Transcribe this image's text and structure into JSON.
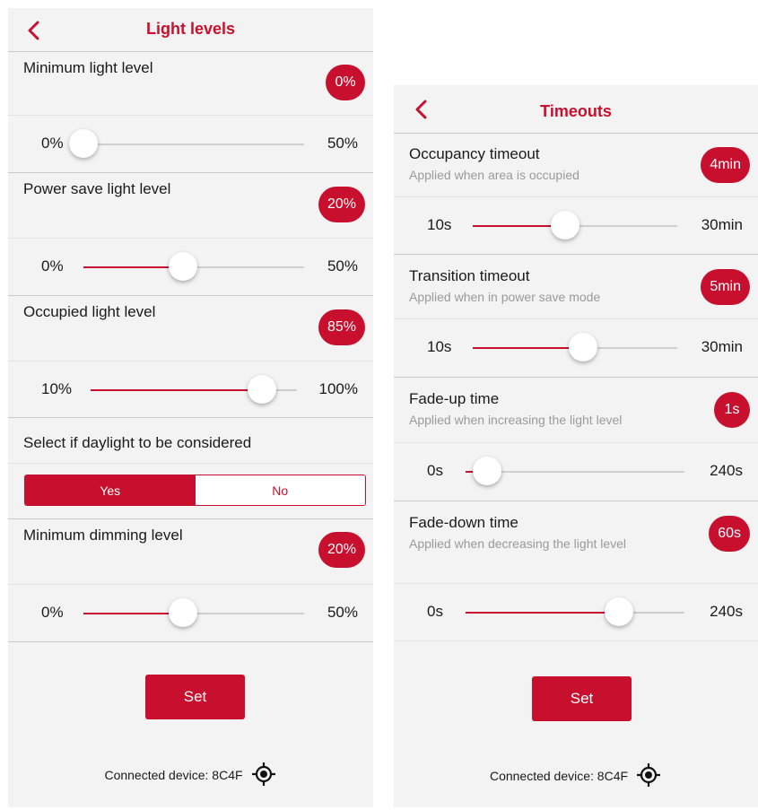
{
  "colors": {
    "accent": "#c8102e",
    "panel_bg": "#f3f3f3",
    "track": "#cfcfcf"
  },
  "left": {
    "title": "Light levels",
    "back_icon": "chevron-left-icon",
    "sliders": [
      {
        "label": "Minimum light level",
        "badge": "0%",
        "min": "0%",
        "max": "50%",
        "fraction": 0.0
      },
      {
        "label": "Power save light level",
        "badge": "20%",
        "min": "0%",
        "max": "50%",
        "fraction": 0.45
      },
      {
        "label": "Occupied light level",
        "badge": "85%",
        "min": "10%",
        "max": "100%",
        "fraction": 0.83
      }
    ],
    "daylight": {
      "label": "Select if daylight to be considered",
      "yes": "Yes",
      "no": "No",
      "selected": "Yes"
    },
    "dimming": {
      "label": "Minimum dimming level",
      "badge": "20%",
      "min": "0%",
      "max": "50%",
      "fraction": 0.45
    },
    "set_label": "Set",
    "footer": "Connected device: 8C4F",
    "footer_icon": "locate-icon"
  },
  "right": {
    "title": "Timeouts",
    "back_icon": "chevron-left-icon",
    "sliders": [
      {
        "label": "Occupancy timeout",
        "sub": "Applied when area is occupied",
        "badge": "4min",
        "min": "10s",
        "max": "30min",
        "fraction": 0.45
      },
      {
        "label": "Transition timeout",
        "sub": "Applied when in power save mode",
        "badge": "5min",
        "min": "10s",
        "max": "30min",
        "fraction": 0.54
      },
      {
        "label": "Fade-up time",
        "sub": "Applied when increasing the light level",
        "badge": "1s",
        "min": "0s",
        "max": "240s",
        "fraction": 0.1
      },
      {
        "label": "Fade-down time",
        "sub": "Applied when decreasing the light level",
        "badge": "60s",
        "min": "0s",
        "max": "240s",
        "fraction": 0.7
      }
    ],
    "set_label": "Set",
    "footer": "Connected device: 8C4F",
    "footer_icon": "locate-icon"
  }
}
